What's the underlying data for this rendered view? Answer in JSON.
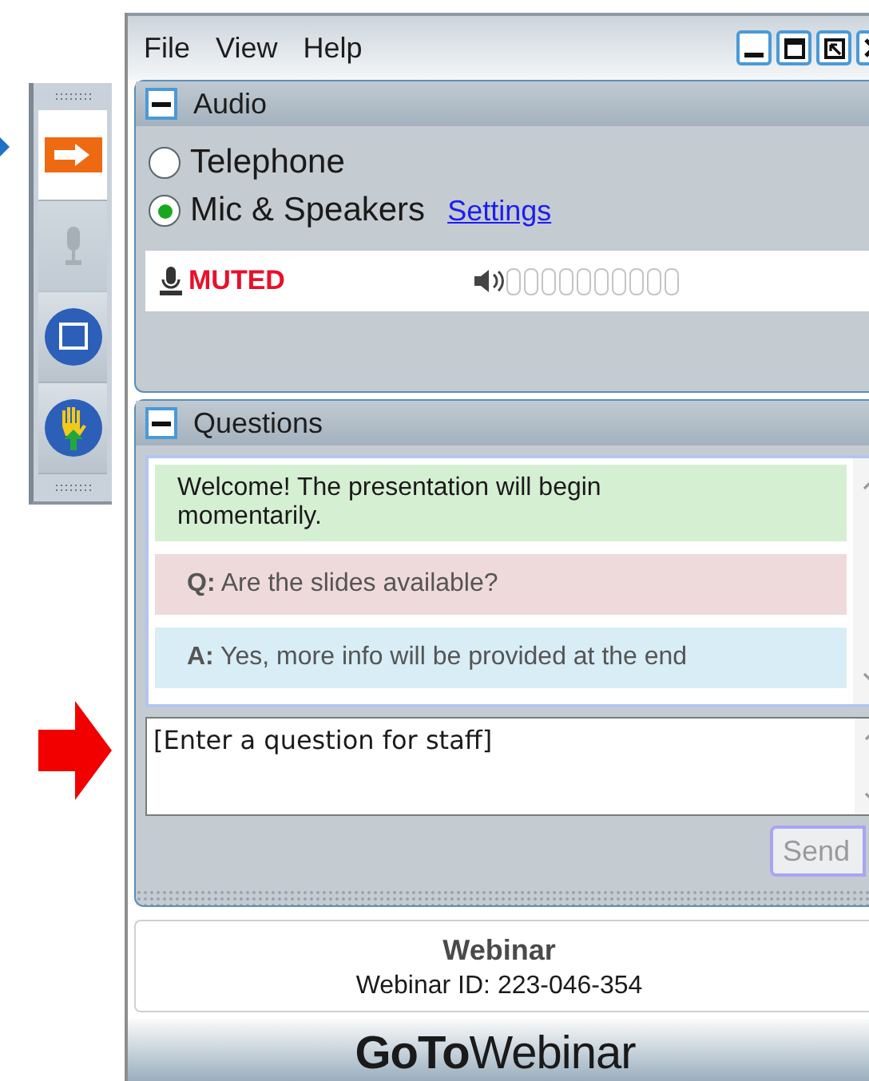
{
  "menu": [
    "File",
    "View",
    "Help"
  ],
  "toolbar": [
    {
      "kind": "arrow",
      "selected": true,
      "disabled": false
    },
    {
      "kind": "mic",
      "selected": false,
      "disabled": true
    },
    {
      "kind": "screen",
      "selected": false,
      "disabled": false
    },
    {
      "kind": "hand",
      "selected": false,
      "disabled": false
    }
  ],
  "audio": {
    "title": "Audio",
    "options": [
      {
        "label": "Telephone",
        "selected": false
      },
      {
        "label": "Mic & Speakers",
        "selected": true
      }
    ],
    "settings_link": "Settings",
    "mic_status": "MUTED"
  },
  "questions": {
    "title": "Questions",
    "messages": [
      {
        "kind": "notice",
        "text": "Welcome!  The presentation  will begin momentarily."
      },
      {
        "kind": "question",
        "text": "**Q:** Are the slides available?"
      },
      {
        "kind": "answer",
        "text": "**A:** Yes, more info will be provided at the end"
      }
    ],
    "input": {
      "placeholder": "[Enter a question for staff]"
    },
    "send_button": {
      "label": "Send",
      "disabled": true
    }
  },
  "footer": {
    "title": "Webinar",
    "webinar_id": "Webinar ID: 223-046-354",
    "logo": "**GoTo**Webinar"
  }
}
